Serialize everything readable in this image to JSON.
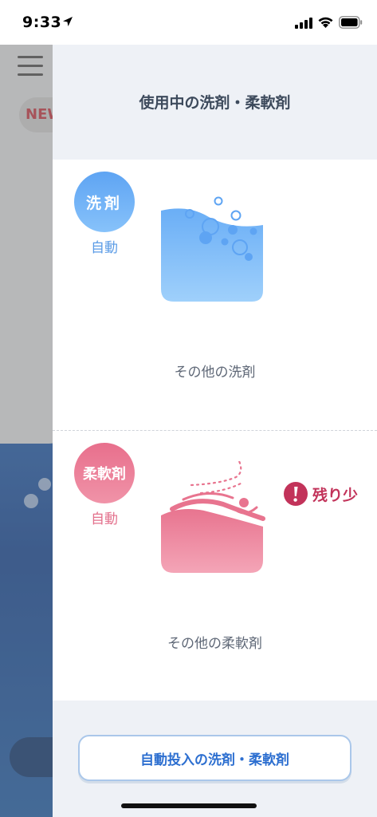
{
  "status_bar": {
    "time": "9:33"
  },
  "background_app": {
    "new_badge": "NEW"
  },
  "drawer": {
    "title": "使用中の洗剤・柔軟剤",
    "detergent": {
      "badge_label": "洗剤",
      "mode": "自動",
      "product_name": "その他の洗剤",
      "icon": "detergent-basin-icon"
    },
    "softener": {
      "badge_label": "柔軟剤",
      "mode": "自動",
      "product_name": "その他の柔軟剤",
      "icon": "softener-basin-icon",
      "warning": "残り少"
    },
    "action_button": "自動投入の洗剤・柔軟剤"
  },
  "colors": {
    "detergent_accent": "#5ea4f3",
    "softener_accent": "#e86f8c",
    "warning": "#c2335a",
    "button_text": "#2d6fd0"
  }
}
